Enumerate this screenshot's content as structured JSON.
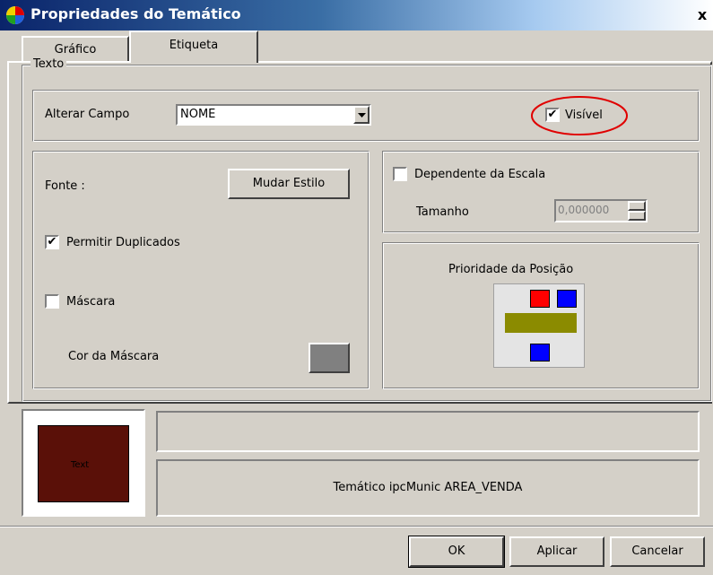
{
  "window": {
    "title": "Propriedades do Temático",
    "close_label": "x"
  },
  "tabs": [
    {
      "label": "Gráfico",
      "active": false
    },
    {
      "label": "Etiqueta",
      "active": true
    }
  ],
  "texto_group": {
    "legend": "Texto",
    "alterar_campo_label": "Alterar Campo",
    "campo_value": "NOME",
    "visivel_label": "Visível",
    "visivel_checked": true
  },
  "font_group": {
    "fonte_label": "Fonte :",
    "mudar_estilo_label": "Mudar Estilo",
    "permitir_duplicados_label": "Permitir Duplicados",
    "permitir_duplicados_checked": true,
    "mascara_label": "Máscara",
    "mascara_checked": false,
    "cor_mascara_label": "Cor da Máscara",
    "mask_color": "#808080"
  },
  "scale_group": {
    "dependente_label": "Dependente da Escala",
    "dependente_checked": false,
    "tamanho_label": "Tamanho",
    "tamanho_value": "0,000000"
  },
  "priority_group": {
    "label": "Prioridade da Posição",
    "colors": {
      "red": "#ff0000",
      "blue": "#0000ff",
      "olive": "#8b8b00"
    }
  },
  "preview": {
    "sample_text": "Text",
    "bg_color": "#5a1008",
    "description": "Temático ipcMunic AREA_VENDA"
  },
  "buttons": {
    "ok": "OK",
    "aplicar": "Aplicar",
    "cancelar": "Cancelar"
  },
  "colors": {
    "checkmark": "✔",
    "annotation_red": "#e00000"
  }
}
